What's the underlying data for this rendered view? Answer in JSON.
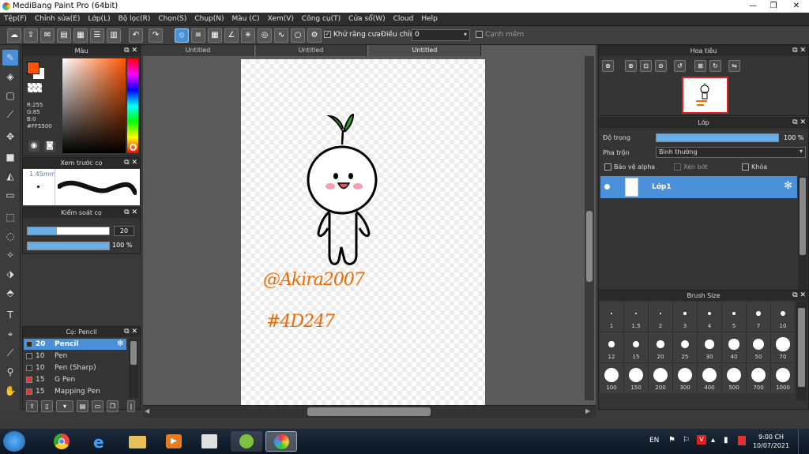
{
  "window": {
    "title": "MediBang Paint Pro (64bit)",
    "minimize": "—",
    "restore": "❐",
    "close": "✕"
  },
  "menu": [
    "Tệp(F)",
    "Chỉnh sửa(E)",
    "Lớp(L)",
    "Bộ lọc(R)",
    "Chọn(S)",
    "Chụp(N)",
    "Màu (C)",
    "Xem(V)",
    "Công cụ(T)",
    "Cửa sổ(W)",
    "Cloud",
    "Help"
  ],
  "toolbar": {
    "antialias_label": "Khử răng cưa",
    "adjust_label": "Điều chỉnh",
    "adjust_value": "0",
    "edge_label": "Cạnh mềm"
  },
  "color_panel": {
    "title": "Màu",
    "r": "R:255",
    "g": "G:85",
    "b": "B:0",
    "hex": "#FF5500",
    "fg": "#FF5500",
    "bg": "#FFFFFF"
  },
  "brush_preview": {
    "title": "Xem trước cọ",
    "size": "1.45mm"
  },
  "brush_control": {
    "title": "Kiểm soát cọ",
    "size_value": "20",
    "size_fill": 0.36,
    "opacity_value": "100 %",
    "opacity_fill": 1.0
  },
  "brush_list": {
    "title": "Cọ: Pencil",
    "items": [
      {
        "size": "20",
        "name": "Pencil",
        "color": "#2a2a2a",
        "selected": true
      },
      {
        "size": "10",
        "name": "Pen",
        "color": "#2a2a2a",
        "selected": false
      },
      {
        "size": "10",
        "name": "Pen (Sharp)",
        "color": "#2a2a2a",
        "selected": false
      },
      {
        "size": "15",
        "name": "G Pen",
        "color": "#e53333",
        "selected": false
      },
      {
        "size": "15",
        "name": "Mapping Pen",
        "color": "#e53333",
        "selected": false
      }
    ]
  },
  "tabs": [
    "Untitled",
    "Untitled",
    "Untitled"
  ],
  "artwork": {
    "signature_line1": "@Akira2007",
    "signature_line2": "#4D247"
  },
  "navigator": {
    "title": "Hoa tiêu"
  },
  "layer_panel": {
    "title": "Lớp",
    "opacity_label": "Độ trong",
    "opacity_value": "100 %",
    "opacity_fill": 1.0,
    "blend_label": "Pha trộn",
    "blend_value": "Bình thường",
    "protect_alpha": "Bảo vệ alpha",
    "clipping": "Xén bớt",
    "lock": "Khóa",
    "layer_name": "Lớp1"
  },
  "brush_size": {
    "title": "Brush Size",
    "sizes": [
      "1",
      "1.5",
      "2",
      "3",
      "4",
      "5",
      "7",
      "10",
      "12",
      "15",
      "20",
      "25",
      "30",
      "40",
      "50",
      "70",
      "100",
      "150",
      "200",
      "300",
      "400",
      "500",
      "700",
      "1000"
    ]
  },
  "taskbar": {
    "lang": "EN",
    "time": "9:00 CH",
    "date": "10/07/2021"
  }
}
